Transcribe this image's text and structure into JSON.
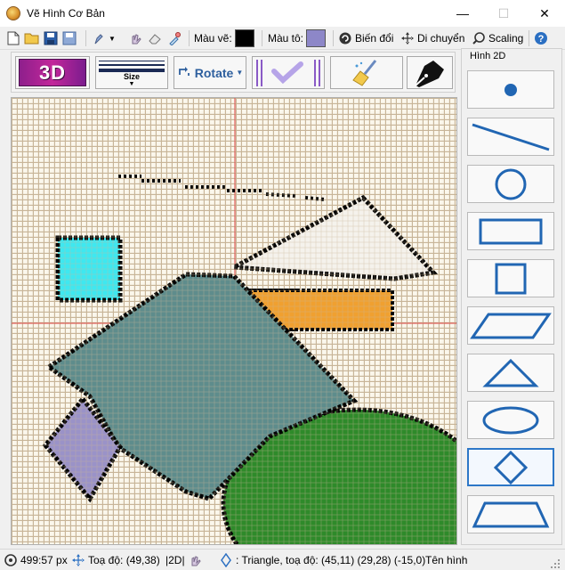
{
  "window": {
    "title": "Vẽ Hình Cơ Bản"
  },
  "toolbar": {
    "draw_color_label": "Màu vẽ:",
    "draw_color": "#000000",
    "fill_color_label": "Màu tô:",
    "fill_color": "#8d87c8",
    "transform_label": "Biến đổi",
    "move_label": "Di chuyển",
    "scaling_label": "Scaling"
  },
  "ribbon": {
    "three_d_label": "3D",
    "size_label": "Size",
    "rotate_label": "Rotate"
  },
  "panel": {
    "title": "Hình 2D",
    "shapes": [
      "point",
      "line",
      "circle",
      "rectangle",
      "square",
      "parallelogram",
      "triangle",
      "ellipse",
      "diamond",
      "trapezoid"
    ],
    "active": "diamond"
  },
  "status": {
    "size": "499:57 px",
    "coord": "Toạ độ: (49,38)",
    "mode": "|2D|",
    "info": ": Triangle, toạ độ: (45,11) (29,28) (-15,0)",
    "shape_name": "Tên hình"
  },
  "colors": {
    "accent": "#2d77c7",
    "cyan": "#3ee8f0",
    "slate": "#5e8c8c",
    "lavender": "#9a92c8",
    "green": "#2e8a2a",
    "purple": "#6a1f8c",
    "orange": "#f0a030",
    "axis": "#e04040"
  }
}
